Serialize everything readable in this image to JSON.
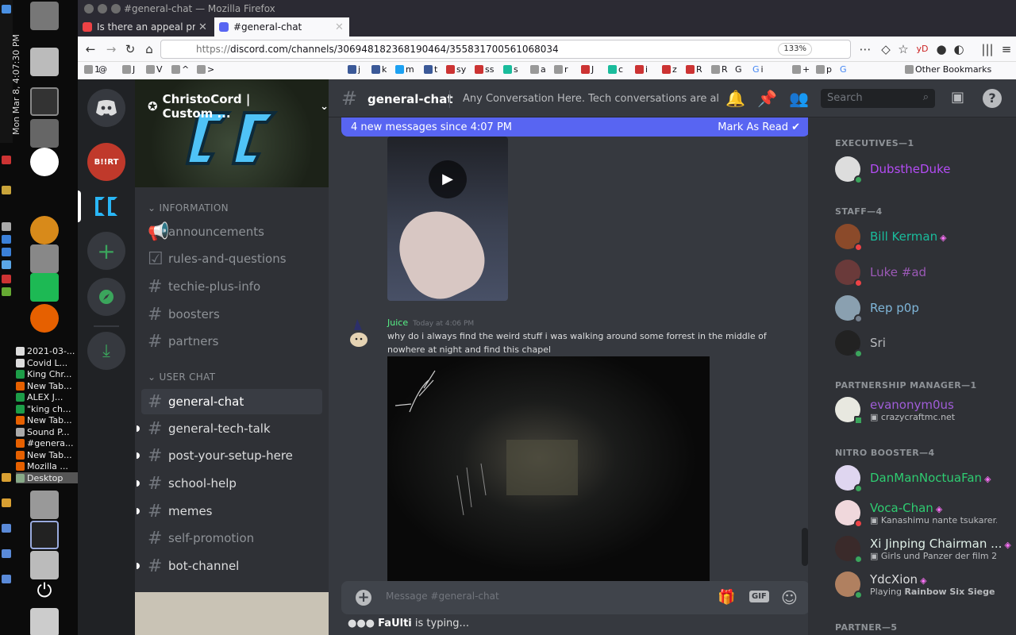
{
  "os": {
    "clock": "Mon Mar 8, 4:07:30 PM",
    "windows": [
      "2021-03-...",
      "Covid L...",
      "King Chr...",
      "New Tab...",
      "ALEX J...",
      "\"king ch...",
      "New Tab...",
      "Sound P...",
      "#genera...",
      "New Tab...",
      "Mozilla ...",
      "Desktop"
    ]
  },
  "browser": {
    "window_title": "#general-chat — Mozilla Firefox",
    "tabs": [
      {
        "label": "Is there an appeal proce",
        "active": false
      },
      {
        "label": "#general-chat",
        "active": true
      }
    ],
    "url_scheme": "https://",
    "url_rest": "discord.com/channels/306948182368190464/355831700561068034",
    "zoom": "133%",
    "bookmarks": [
      "1",
      "@",
      "J",
      "V",
      "^",
      ">",
      "j",
      "k",
      "m",
      "t",
      "sy",
      "ss",
      "s",
      "a",
      "r",
      "J",
      "c",
      "i",
      "z",
      "R",
      "R",
      "G",
      "i",
      "+",
      "p",
      "G"
    ],
    "other_bookmarks": "Other Bookmarks"
  },
  "server": {
    "name": "ChristoCord | Custom ...",
    "categories": {
      "information": "INFORMATION",
      "user_chat": "USER CHAT"
    },
    "info_channels": [
      "announcements",
      "rules-and-questions",
      "techie-plus-info",
      "boosters",
      "partners"
    ],
    "chat_channels": [
      "general-chat",
      "general-tech-talk",
      "post-your-setup-here",
      "school-help",
      "memes",
      "self-promotion",
      "bot-channel"
    ],
    "guild_badge": "B!!RT"
  },
  "chat": {
    "channel": "general-chat",
    "topic": "Any Conversation Here. Tech conversations are all...",
    "search_placeholder": "Search",
    "new_messages": "4 new messages since 4:07 PM",
    "mark_read": "Mark As Read",
    "message": {
      "author": "Juice",
      "timestamp": "Today at 4:06 PM",
      "text": "why do i always find the weird stuff i was walking around some forrest in the middle of nowhere at night and find this chapel"
    },
    "composer_placeholder": "Message #general-chat",
    "typing_user": "FaUlti",
    "typing_suffix": "is typing...",
    "gif_label": "GIF"
  },
  "members": {
    "groups": [
      {
        "title": "EXECUTIVES—1"
      },
      {
        "title": "STAFF—4"
      },
      {
        "title": "PARTNERSHIP MANAGER—1"
      },
      {
        "title": "NITRO BOOSTER—4"
      },
      {
        "title": "PARTNER—5"
      }
    ],
    "list": [
      {
        "name": "DubstheDuke",
        "color": "#b44cf5",
        "status": ""
      },
      {
        "name": "Bill Kerman",
        "color": "#1abc9c",
        "status": ""
      },
      {
        "name": "Luke #ad",
        "color": "#9b59b6",
        "status": ""
      },
      {
        "name": "Rep p0p",
        "color": "#7fb6d9",
        "status": ""
      },
      {
        "name": "Sri",
        "color": "#b9bbbe",
        "status": ""
      },
      {
        "name": "evanonym0us",
        "color": "#a05dd8",
        "status": "crazycraftmc.net"
      },
      {
        "name": "DanManNoctuaFan",
        "color": "#2ecc71",
        "status": ""
      },
      {
        "name": "Voca-Chan",
        "color": "#2ecc71",
        "status": "Kanashimu nante tsukarer..."
      },
      {
        "name": "Xi Jinping Chairman ...",
        "color": "#e0f0e8",
        "status": "Girls und Panzer der film 2?"
      },
      {
        "name": "YdcXion",
        "color": "#dcddde",
        "status_prefix": "Playing ",
        "status": "Rainbow Six Siege"
      }
    ]
  },
  "colors": {
    "accent": "#5865f2",
    "online": "#3ba55c",
    "dnd": "#ed4245",
    "background": "#36393f"
  }
}
